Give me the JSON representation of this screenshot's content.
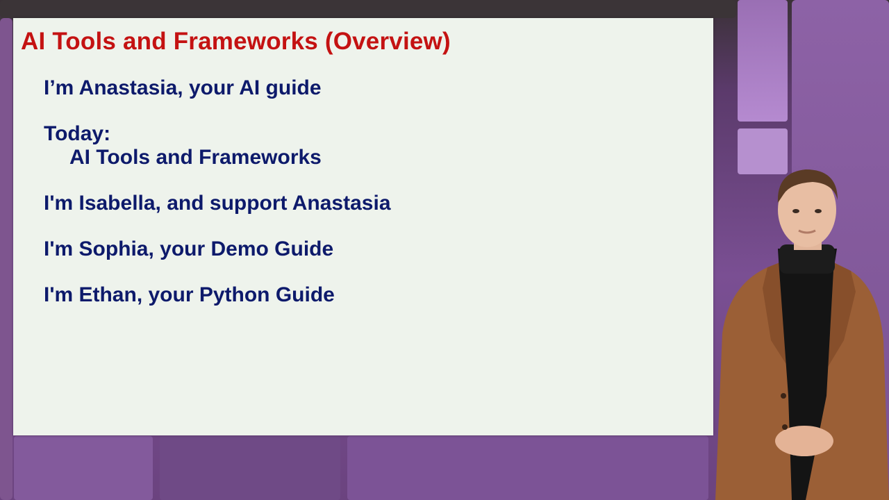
{
  "slide": {
    "title": "AI Tools and Frameworks (Overview)",
    "lines": [
      "I’m Anastasia, your AI guide",
      "Today:",
      "AI Tools and Frameworks",
      "I'm Isabella, and support Anastasia",
      "I'm Sophia, your Demo Guide",
      "I'm Ethan, your Python Guide"
    ]
  },
  "colors": {
    "title": "#c41212",
    "body_text": "#0d1a6b",
    "slide_background": "#eef3ec",
    "page_background": "#7a4f93",
    "jacket": "#9b5f36"
  },
  "presenter": {
    "description_icon": "presenter-figure"
  }
}
